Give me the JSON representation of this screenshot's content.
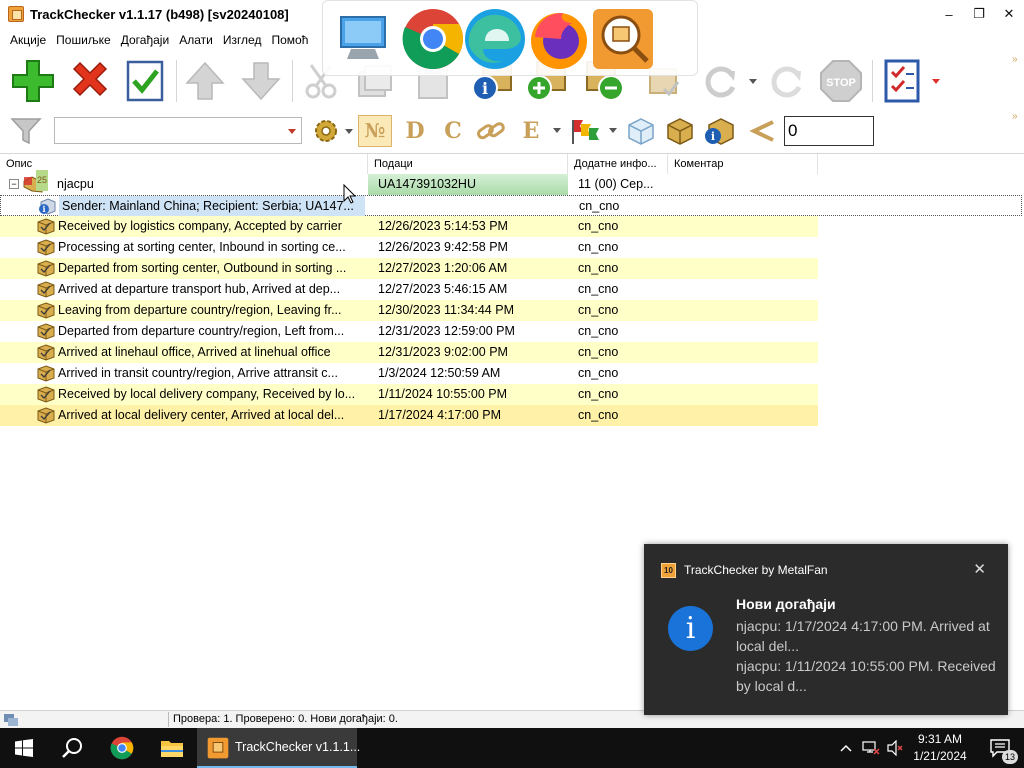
{
  "window": {
    "title": "TrackChecker v1.1.17 (b498)  [sv20240108]",
    "minimize": "–",
    "maximize": "❐",
    "close": "✕"
  },
  "menu": [
    "Акције",
    "Пошиљке",
    "Догађаји",
    "Алати",
    "Изглед",
    "Помоћ"
  ],
  "toolbar2": {
    "filter_value": "",
    "letter_buttons": [
      "№",
      "D",
      "C",
      "E"
    ],
    "numeric_value": "0"
  },
  "grid": {
    "columns": [
      "Опис",
      "Подаци",
      "Додатне инфо...",
      "Коментар"
    ],
    "parcel": {
      "badge": "25",
      "name": "njacpu",
      "data": "UA147391032HU",
      "extra": "11 (00) Сер...",
      "expander": "−"
    },
    "events": [
      {
        "description": "Sender: Mainland China; Recipient: Serbia; UA147...",
        "date": "",
        "extra": "cn_cno"
      },
      {
        "description": "Received by logistics company, Accepted by carrier",
        "date": "12/26/2023 5:14:53 PM",
        "extra": "cn_cno"
      },
      {
        "description": "Processing at sorting center, Inbound in sorting ce...",
        "date": "12/26/2023 9:42:58 PM",
        "extra": "cn_cno"
      },
      {
        "description": "Departed from sorting center, Outbound in sorting ...",
        "date": "12/27/2023 1:20:06 AM",
        "extra": "cn_cno"
      },
      {
        "description": "Arrived at departure transport hub, Arrived at dep...",
        "date": "12/27/2023 5:46:15 AM",
        "extra": "cn_cno"
      },
      {
        "description": "Leaving from departure country/region, Leaving fr...",
        "date": "12/30/2023 11:34:44 PM",
        "extra": "cn_cno"
      },
      {
        "description": "Departed from departure country/region, Left from...",
        "date": "12/31/2023 12:59:00 PM",
        "extra": "cn_cno"
      },
      {
        "description": "Arrived at linehaul office, Arrived at linehual office",
        "date": "12/31/2023 9:02:00 PM",
        "extra": "cn_cno"
      },
      {
        "description": "Arrived in transit country/region, Arrive attransit c...",
        "date": "1/3/2024 12:50:59 AM",
        "extra": "cn_cno"
      },
      {
        "description": "Received by local delivery company, Received by lo...",
        "date": "1/11/2024 10:55:00 PM",
        "extra": "cn_cno"
      },
      {
        "description": "Arrived at local delivery center, Arrived at local del...",
        "date": "1/17/2024 4:17:00 PM",
        "extra": "cn_cno"
      }
    ]
  },
  "status": {
    "text": "Провера: 1. Проверено: 0. Нови догађаји: 0."
  },
  "toast": {
    "app_badge": "10",
    "app_name": "TrackChecker by MetalFan",
    "close": "✕",
    "icon": "i",
    "title": "Нови догађаји",
    "line1": "njacpu: 1/17/2024 4:17:00 PM. Arrived at local del...",
    "line2": "njacpu: 1/11/2024 10:55:00 PM. Received by local d..."
  },
  "taskbar": {
    "active_app": "TrackChecker v1.1.1...",
    "time": "9:31 AM",
    "date": "1/21/2024",
    "notification_count": "13"
  },
  "colors": {
    "row_yellow": "#ffffc8",
    "row_selected_yellow": "#fff2a8",
    "selection_blue": "#cfe3f6",
    "parcel_data_green": "#b8e3b8",
    "toast_bg": "#2b2b2b",
    "taskbar_bg": "#101010"
  }
}
